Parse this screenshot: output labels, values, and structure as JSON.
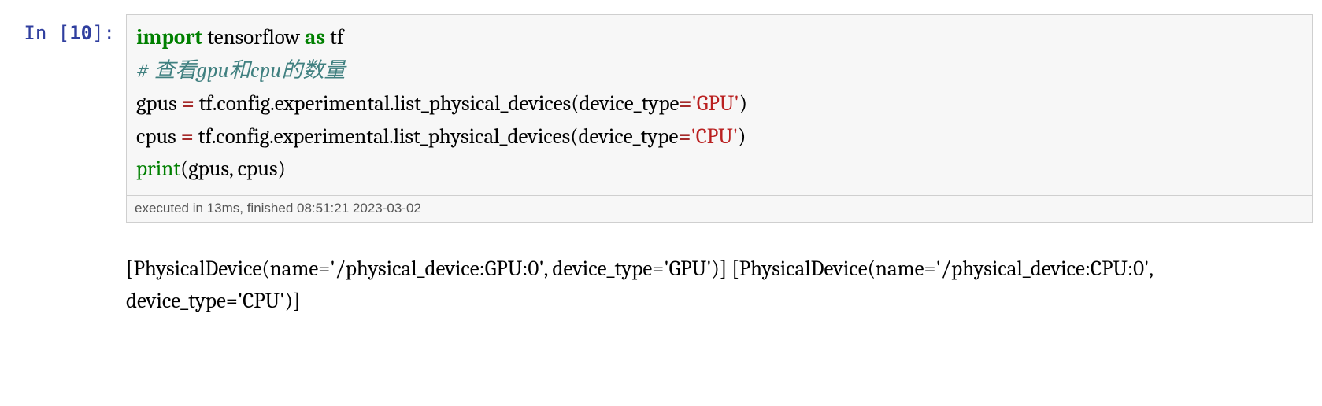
{
  "prompt": {
    "label": "In",
    "num": "10"
  },
  "code": {
    "l1_kw1": "import",
    "l1_mod": " tensorflow ",
    "l1_kw2": "as",
    "l1_alias": " tf",
    "l2_comment": "# 查看gpu和cpu的数量",
    "l3_lhs": "gpus ",
    "l3_op": "=",
    "l3_call_a": " tf.config.experimental.list_physical_devices(device_type",
    "l3_eq": "=",
    "l3_str": "'GPU'",
    "l3_close": ")",
    "l4_lhs": "cpus ",
    "l4_op": "=",
    "l4_call_a": " tf.config.experimental.list_physical_devices(device_type",
    "l4_eq": "=",
    "l4_str": "'CPU'",
    "l4_close": ")",
    "l5_fn": "print",
    "l5_args": "(gpus, cpus)"
  },
  "exec": "executed in 13ms, finished 08:51:21 2023-03-02",
  "output": "[PhysicalDevice(name='/physical_device:GPU:0', device_type='GPU')] [PhysicalDevice(name='/physical_device:CPU:0', device_type='CPU')]"
}
